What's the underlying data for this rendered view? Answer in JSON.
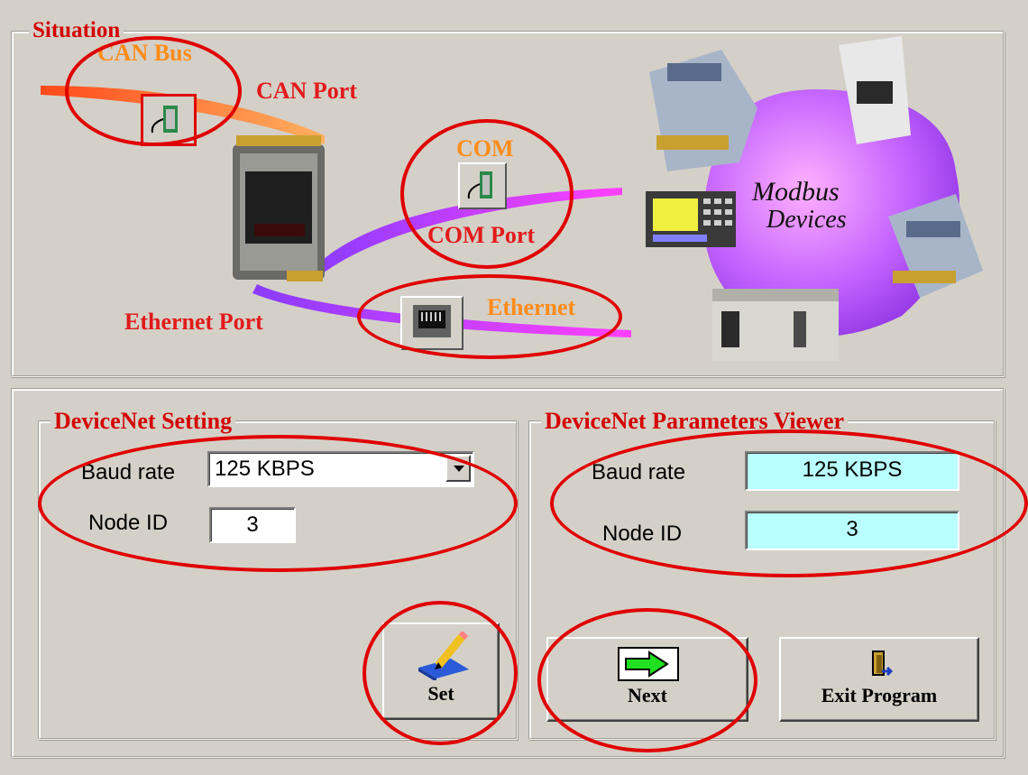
{
  "situation": {
    "legend": "Situation",
    "can_bus": "CAN Bus",
    "can_port": "CAN Port",
    "com": "COM",
    "com_port": "COM Port",
    "ethernet": "Ethernet",
    "ethernet_port": "Ethernet Port",
    "modbus_devices_line1": "Modbus",
    "modbus_devices_line2": "Devices"
  },
  "devicenet_setting": {
    "legend": "DeviceNet  Setting",
    "baud_rate_label": "Baud rate",
    "baud_rate_value": "125 KBPS",
    "node_id_label": "Node ID",
    "node_id_value": "3",
    "set_button": "Set"
  },
  "parameters_viewer": {
    "legend": "DeviceNet Parameters Viewer",
    "baud_rate_label": "Baud rate",
    "baud_rate_value": "125 KBPS",
    "node_id_label": "Node ID",
    "node_id_value": "3",
    "next_button": "Next",
    "exit_button": "Exit Program"
  },
  "colors": {
    "background": "#d4d0c8",
    "annotation_red": "#e00000",
    "viewer_field": "#b9ffff",
    "label_red": "#e31a1a",
    "label_orange": "#ff8c1a"
  }
}
